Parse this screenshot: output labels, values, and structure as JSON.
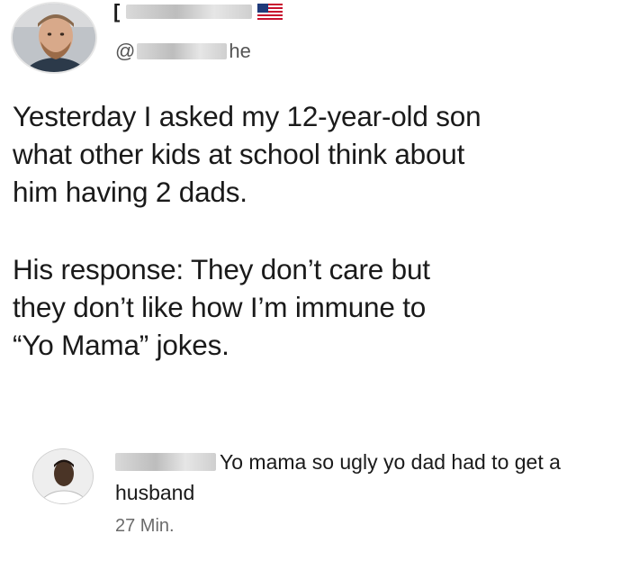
{
  "post": {
    "author_name_visible": "[",
    "handle_prefix": "@",
    "handle_suffix": "he",
    "flag_icon": "us-flag-icon",
    "paragraph1": "Yesterday I asked my 12-year-old son\nwhat other kids at school think about\nhim having 2 dads.",
    "paragraph2": "His response: They don’t care but\nthey don’t like how I’m immune to\n“Yo Mama” jokes."
  },
  "comment": {
    "text": "Yo mama so ugly yo dad had to get a husband",
    "time": "27 Min."
  },
  "colors": {
    "text": "#1a1a1a",
    "muted": "#6b6b6b",
    "redaction": "#cfcfcf"
  }
}
